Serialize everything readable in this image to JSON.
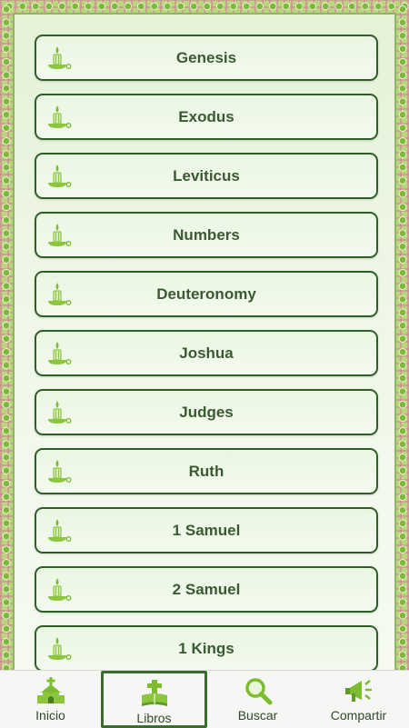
{
  "books": [
    {
      "name": "Genesis"
    },
    {
      "name": "Exodus"
    },
    {
      "name": "Leviticus"
    },
    {
      "name": "Numbers"
    },
    {
      "name": "Deuteronomy"
    },
    {
      "name": "Joshua"
    },
    {
      "name": "Judges"
    },
    {
      "name": "Ruth"
    },
    {
      "name": "1 Samuel"
    },
    {
      "name": "2 Samuel"
    },
    {
      "name": "1 Kings"
    }
  ],
  "book_icon": "candle-icon",
  "nav": [
    {
      "label": "Inicio",
      "icon": "church-icon",
      "active": false
    },
    {
      "label": "Libros",
      "icon": "bible-icon",
      "active": true
    },
    {
      "label": "Buscar",
      "icon": "magnifier-icon",
      "active": false
    },
    {
      "label": "Compartir",
      "icon": "megaphone-icon",
      "active": false
    }
  ],
  "colors": {
    "accent": "#3c6b2e",
    "button_border": "#2f5f28",
    "border_green": "#b9d67d",
    "border_pink": "#d67aa0",
    "icon_green": "#7cbd2f"
  }
}
